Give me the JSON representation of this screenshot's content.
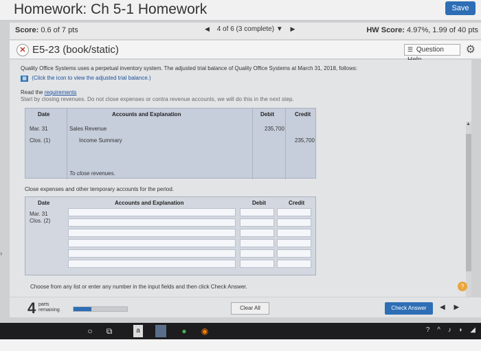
{
  "header": {
    "title": "Homework: Ch 5-1 Homework",
    "save_label": "Save"
  },
  "score": {
    "label": "Score:",
    "value": "0.6 of 7 pts"
  },
  "nav": {
    "prev": "◀",
    "position": "4 of 6 (3 complete)",
    "menu": "▼",
    "next": "▶"
  },
  "hw_score": {
    "label": "HW Score:",
    "value": "4.97%, 1.99 of 40 pts"
  },
  "question": {
    "title": "E5-23 (book/static)",
    "help_label": "Question Help"
  },
  "intro": {
    "text": "Quality Office Systems uses a perpetual inventory system. The adjusted trial balance of Quality Office Systems at March 31, 2018, follows:",
    "click_note": "(Click the icon to view the adjusted trial balance.)",
    "read_prefix": "Read the",
    "read_link": "requirements",
    "faded_text": "Start by closing revenues. Do not close expenses or contra revenue accounts, we will do this in the next step."
  },
  "table1": {
    "headers": {
      "date": "Date",
      "accounts": "Accounts and Explanation",
      "debit": "Debit",
      "credit": "Credit"
    },
    "rows": [
      {
        "date": "Mar. 31",
        "account": "Sales Revenue",
        "debit": "235,700",
        "credit": ""
      },
      {
        "date": "Clos. (1)",
        "account": "Income Summary",
        "debit": "",
        "credit": "235,700"
      }
    ],
    "explanation": "To close revenues."
  },
  "close_expenses_text": "Close expenses and other temporary accounts for the period.",
  "table2": {
    "headers": {
      "date": "Date",
      "accounts": "Accounts and Explanation",
      "debit": "Debit",
      "credit": "Credit"
    },
    "date1": "Mar. 31",
    "date2": "Clos. (2)"
  },
  "instructions": "Choose from any list or enter any number in the input fields and then click Check Answer.",
  "bottom": {
    "parts_count": "4",
    "parts_label_1": "parts",
    "parts_label_2": "remaining",
    "progress_fraction": 0.33,
    "clear_label": "Clear All",
    "check_label": "Check Answer"
  },
  "colors": {
    "accent": "#2d6eb5",
    "help_orange": "#e9a53a"
  }
}
